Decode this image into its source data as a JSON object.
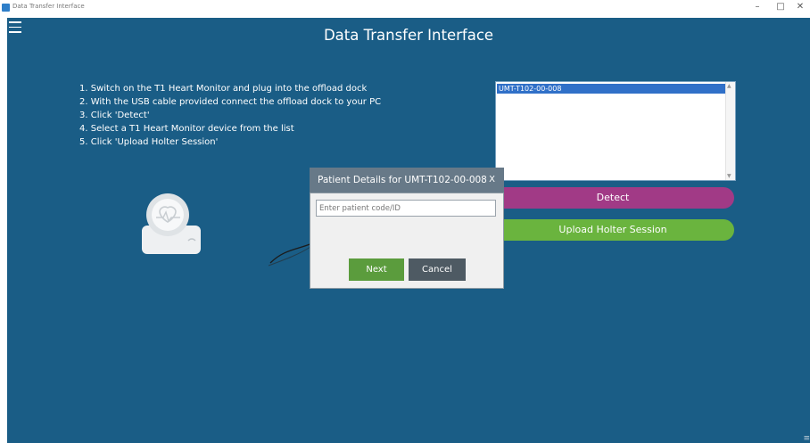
{
  "window": {
    "title": "Data Transfer Interface",
    "controls": {
      "minimize": "–",
      "maximize": "□",
      "close": "✕"
    }
  },
  "header": {
    "menu_icon": "hamburger-menu-icon",
    "title": "Data Transfer Interface"
  },
  "instructions": [
    "1. Switch on the T1 Heart Monitor and plug into the offload dock",
    "2. With the USB cable provided connect the offload dock to your PC",
    "3. Click 'Detect'",
    "4. Select a T1 Heart Monitor device from the list",
    "5. Click 'Upload Holter Session'"
  ],
  "device_list": {
    "items": [
      "UMT-T102-00-008"
    ],
    "selected": "UMT-T102-00-008"
  },
  "buttons": {
    "detect": "Detect",
    "upload": "Upload Holter Session"
  },
  "colors": {
    "background": "#1a5d86",
    "detect": "#a13a86",
    "upload": "#6ab43e",
    "next": "#5b9c3d",
    "cancel": "#4e5a63"
  },
  "dialog": {
    "title": "Patient Details for UMT-T102-00-008",
    "close": "X",
    "input_placeholder": "Enter patient code/ID",
    "input_value": "",
    "next_label": "Next",
    "cancel_label": "Cancel"
  }
}
